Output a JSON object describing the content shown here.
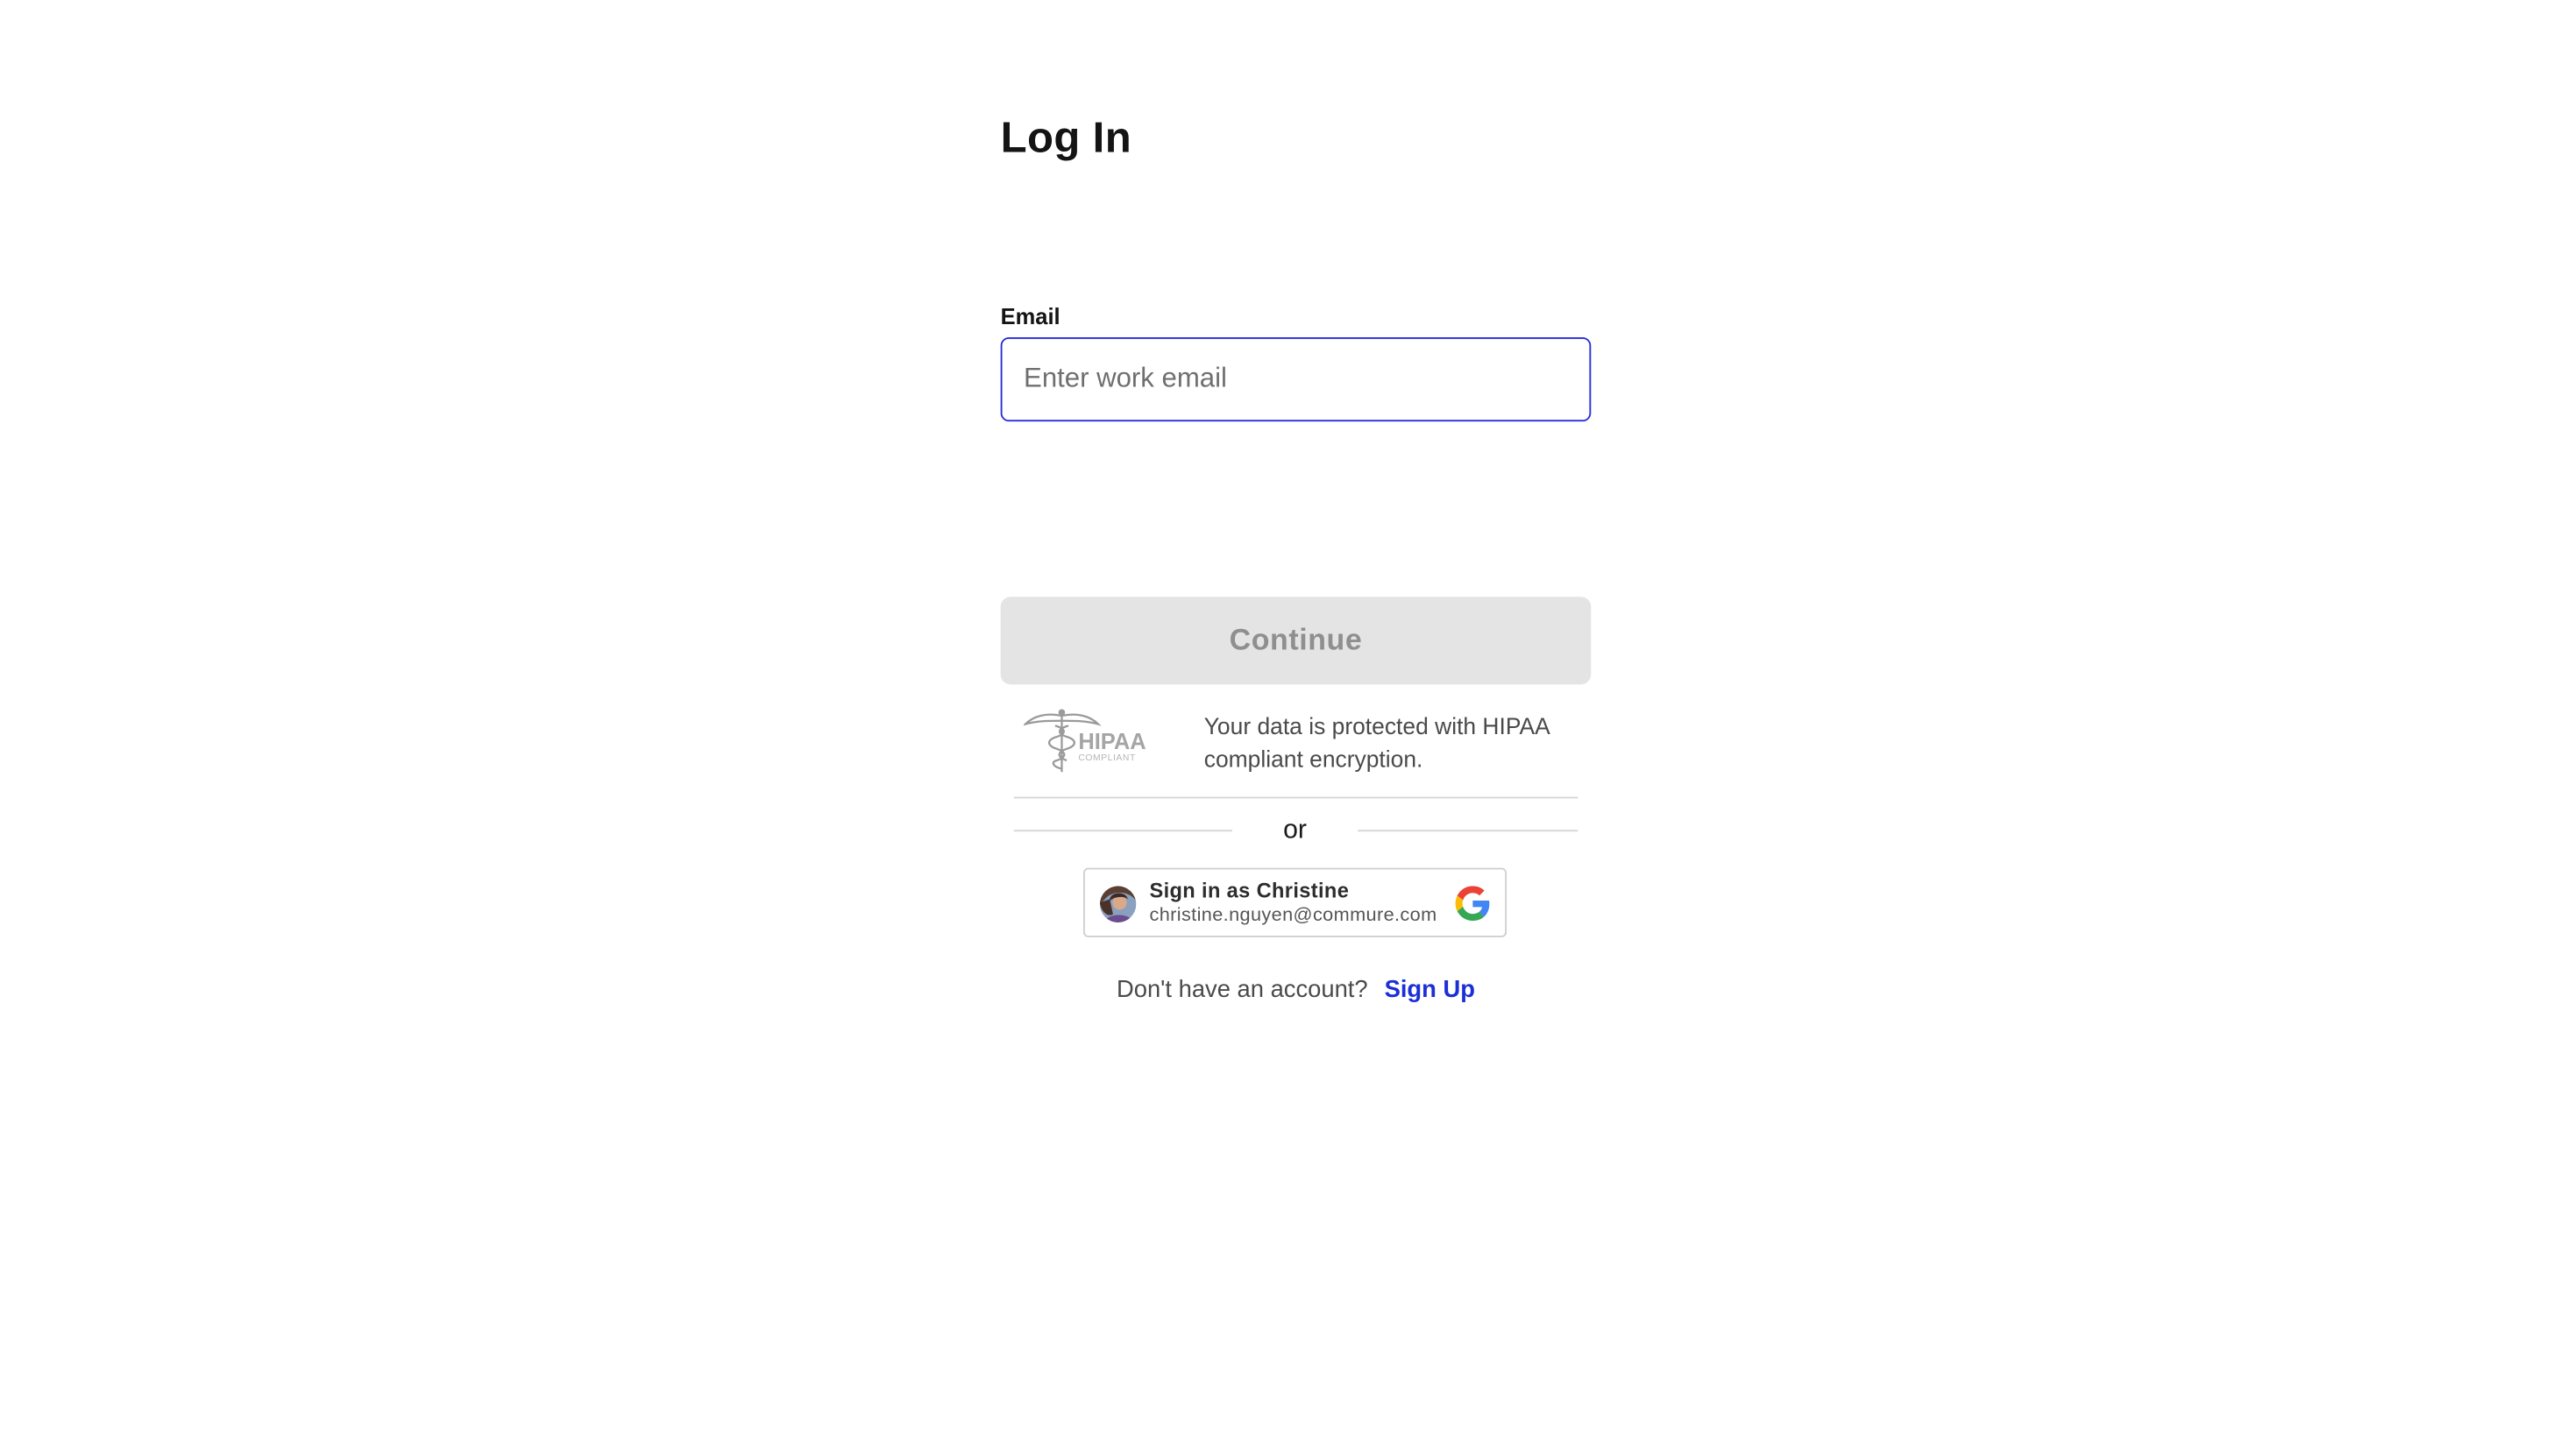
{
  "page": {
    "title": "Log In"
  },
  "email": {
    "label": "Email",
    "placeholder": "Enter work email",
    "value": ""
  },
  "continue": {
    "label": "Continue"
  },
  "hipaa": {
    "logo_text": "HIPAA",
    "logo_subtext": "COMPLIANT",
    "message": "Your data is protected with HIPAA compliant encryption."
  },
  "divider": {
    "text": "or"
  },
  "google": {
    "title": "Sign in as Christine",
    "email": "christine.nguyen@commure.com",
    "icon": "google-g-icon"
  },
  "signup": {
    "prompt": "Don't have an account?",
    "link_label": "Sign Up"
  },
  "colors": {
    "accent": "#1b2fd6",
    "input_border": "#2a2fd6",
    "button_disabled_bg": "#e4e4e4",
    "button_disabled_text": "#8f8f8f"
  }
}
